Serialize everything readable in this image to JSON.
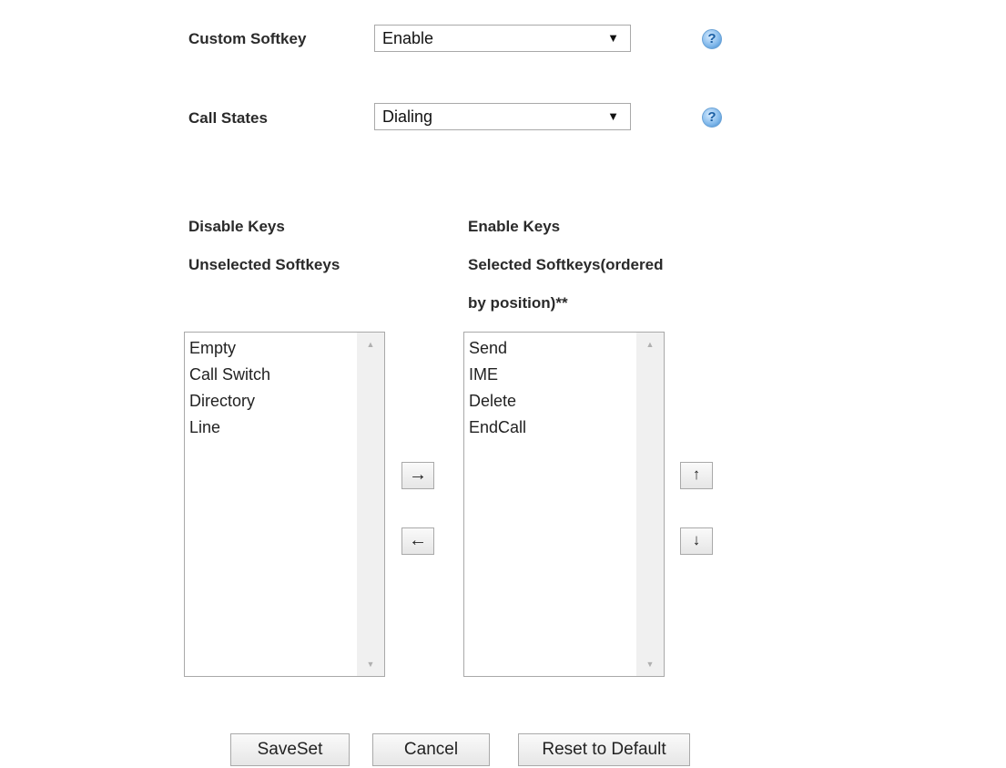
{
  "custom_softkey": {
    "label": "Custom Softkey",
    "value": "Enable",
    "help": "?"
  },
  "call_states": {
    "label": "Call States",
    "value": "Dialing",
    "help": "?"
  },
  "disable_keys": {
    "heading": "Disable Keys",
    "subheading": "Unselected Softkeys",
    "items": [
      "Empty",
      "Call Switch",
      "Directory",
      "Line"
    ]
  },
  "enable_keys": {
    "heading": "Enable Keys",
    "subheading_line1": "Selected Softkeys(ordered",
    "subheading_line2": "by position)**",
    "items": [
      "Send",
      "IME",
      "Delete",
      "EndCall"
    ]
  },
  "transfer": {
    "move_right": "→",
    "move_left": "←"
  },
  "order": {
    "move_up": "↑",
    "move_down": "↓"
  },
  "actions": {
    "save": "SaveSet",
    "cancel": "Cancel",
    "reset": "Reset to Default"
  },
  "icons": {
    "dropdown_arrow": "▼",
    "scroll_up": "▲",
    "scroll_down": "▼"
  }
}
